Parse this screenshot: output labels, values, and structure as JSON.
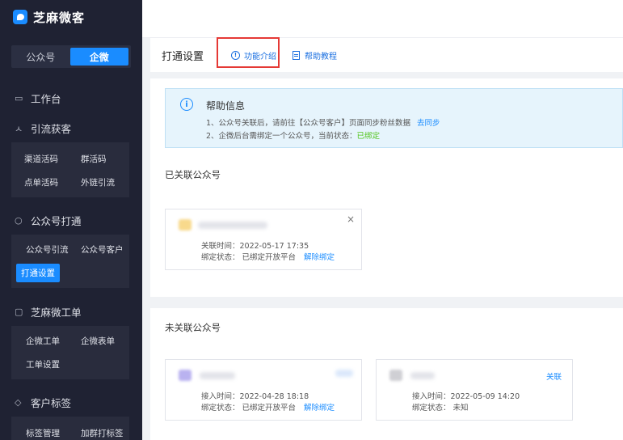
{
  "brand": {
    "name": "芝麻微客"
  },
  "account_switch": {
    "left": "公众号",
    "right": "企微"
  },
  "nav": {
    "workbench": "工作台",
    "traffic": {
      "title": "引流获客",
      "items": [
        "渠道活码",
        "群活码",
        "点单活码",
        "外链引流"
      ]
    },
    "oa_connect": {
      "title": "公众号打通",
      "items": [
        "公众号引流",
        "公众号客户",
        "打通设置"
      ]
    },
    "ticket": {
      "title": "芝麻微工单",
      "items": [
        "企微工单",
        "企微表单",
        "工单设置"
      ]
    },
    "tags": {
      "title": "客户标签",
      "items": [
        "标签管理",
        "加群打标签"
      ]
    }
  },
  "tabs": {
    "title": "打通设置",
    "feature_intro": "功能介绍",
    "tutorial": "帮助教程"
  },
  "help": {
    "title": "帮助信息",
    "line1": "1、公众号关联后，请前往【公众号客户】页面同步粉丝数据",
    "line1_link": "去同步",
    "line2": "2、企微后台需绑定一个公众号，当前状态：",
    "line2_status": "已绑定"
  },
  "linked": {
    "title": "已关联公众号",
    "card": {
      "close": "×",
      "time": "关联时间：2022-05-17 17:35",
      "status": "绑定状态：  已绑定开放平台",
      "action": "解除绑定"
    }
  },
  "unlinked": {
    "title": "未关联公众号",
    "cards": [
      {
        "time": "接入时间：2022-04-28 18:18",
        "status": "绑定状态：  已绑定开放平台",
        "action": "解除绑定"
      },
      {
        "time": "接入时间：2022-05-09 14:20",
        "status": "绑定状态：  未知",
        "action": "关联"
      }
    ]
  },
  "colors": {
    "accent": "#1a8cff",
    "sidebar": "#1f2233",
    "highlight_box": "#e53935",
    "success": "#52c41a"
  }
}
